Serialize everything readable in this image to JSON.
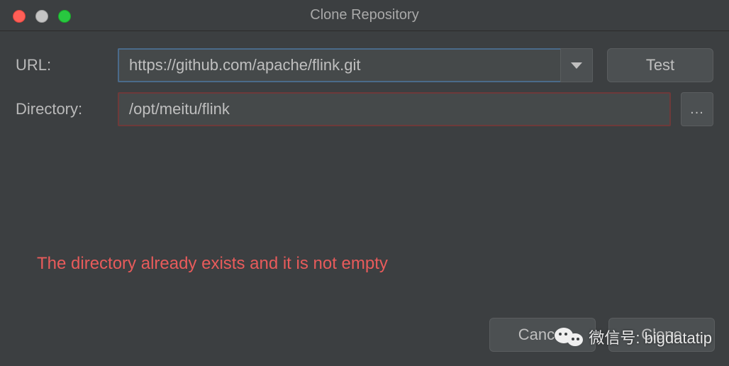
{
  "window": {
    "title": "Clone Repository"
  },
  "form": {
    "url_label": "URL:",
    "url_value": "https://github.com/apache/flink.git",
    "test_label": "Test",
    "directory_label": "Directory:",
    "directory_value": "/opt/meitu/flink",
    "browse_label": "..."
  },
  "error": {
    "message": "The directory already exists and it is not empty"
  },
  "footer": {
    "cancel_label": "Cancel",
    "clone_label": "Clone"
  },
  "watermark": {
    "text": "微信号: bigdatatip"
  },
  "colors": {
    "bg": "#3c3f41",
    "input_bg": "#45494a",
    "btn_bg": "#4c5052",
    "text": "#bfbfbf",
    "error": "#e85b5b",
    "url_border": "#4a6a8a",
    "dir_border_error": "#6e3a3a"
  }
}
